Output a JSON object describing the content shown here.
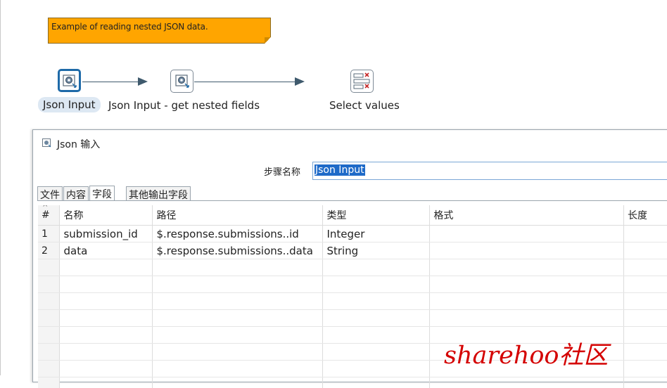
{
  "canvas": {
    "note_text": "Example of reading nested JSON data.",
    "steps": [
      {
        "label": "Json Input",
        "icon": "json-input-icon"
      },
      {
        "label": "Json Input - get nested fields",
        "icon": "json-input-icon"
      },
      {
        "label": "Select values",
        "icon": "select-values-icon"
      }
    ]
  },
  "dialog": {
    "title": "Json 输入",
    "stepname_label": "步骤名称",
    "stepname_value": "Json Input",
    "tabs": [
      "文件",
      "内容",
      "字段",
      "其他输出字段"
    ],
    "active_tab": "字段",
    "columns": [
      "#",
      "名称",
      "路径",
      "类型",
      "格式",
      "长度"
    ],
    "rows": [
      {
        "num": "1",
        "name": "submission_id",
        "path": "$.response.submissions..id",
        "type": "Integer",
        "format": "",
        "length": ""
      },
      {
        "num": "2",
        "name": "data",
        "path": "$.response.submissions..data",
        "type": "String",
        "format": "",
        "length": ""
      }
    ]
  },
  "watermark": "sharehoo社区",
  "colors": {
    "note": "#ffa500",
    "selection": "#1e6ac8",
    "hop": "#3f5a6d",
    "watermark": "#d40000"
  }
}
